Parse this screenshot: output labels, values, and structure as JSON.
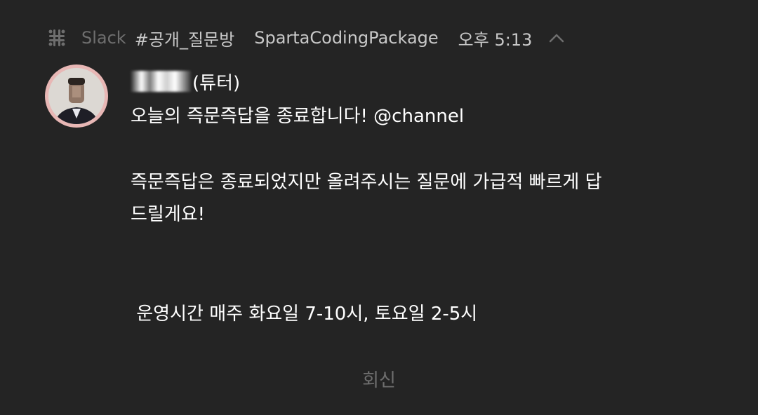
{
  "header": {
    "app_name": "Slack",
    "channel": "#공개_질문방",
    "workspace": "SpartaCodingPackage",
    "time": "오후 5:13"
  },
  "sender": {
    "name_suffix": "(튜터)"
  },
  "message": {
    "line1": "오늘의 즉문즉답을 종료합니다! @channel",
    "line2": "즉문즉답은 종료되었지만 올려주시는 질문에 가급적 빠르게 답",
    "line3": "드릴게요!",
    "line4": " 운영시간 매주 화요일 7-10시, 토요일 2-5시"
  },
  "actions": {
    "reply_label": "회신"
  },
  "colors": {
    "background": "#242424",
    "text_primary": "#ffffff",
    "text_secondary": "#c8c8c8",
    "text_muted": "#6f6f6f",
    "avatar_ring": "#e8b7b5"
  },
  "icons": {
    "app": "slack-icon",
    "collapse": "chevron-up-icon"
  }
}
